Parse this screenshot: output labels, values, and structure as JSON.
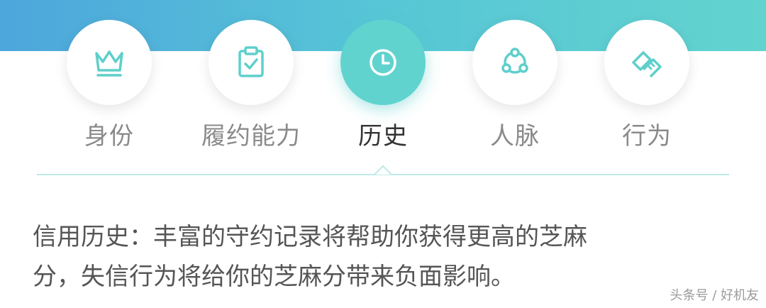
{
  "tabs": [
    {
      "label": "身份",
      "icon": "crown-icon"
    },
    {
      "label": "履约能力",
      "icon": "clipboard-check-icon"
    },
    {
      "label": "历史",
      "icon": "clock-icon"
    },
    {
      "label": "人脉",
      "icon": "network-icon"
    },
    {
      "label": "行为",
      "icon": "handshake-icon"
    }
  ],
  "active_tab": "历史",
  "description": {
    "line1": "信用历史：丰富的守约记录将帮助你获得更高的芝麻",
    "line2": "分，失信行为将给你的芝麻分带来负面影响。"
  },
  "watermark": "头条号 / 好机友",
  "colors": {
    "accent": "#61d3cf",
    "icon_stroke": "#5fcfcb",
    "header_gradient_start": "#4da6dc",
    "header_gradient_end": "#63d3cf"
  }
}
